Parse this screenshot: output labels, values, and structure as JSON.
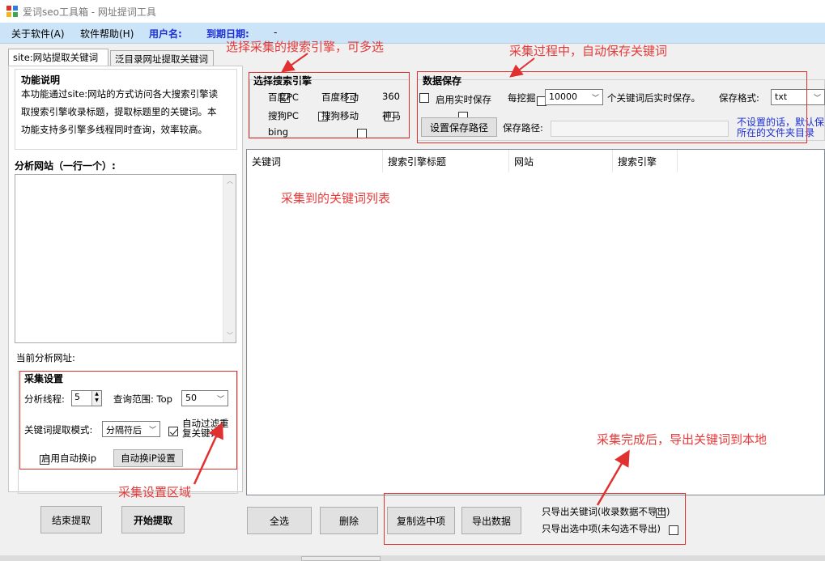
{
  "window": {
    "title": "爱词seo工具箱 - 网址提词工具"
  },
  "menu": {
    "about": "关于软件(A)",
    "help": "软件帮助(H)",
    "username_label": "用户名:",
    "expiry_label": "到期日期:",
    "expiry_value": "-"
  },
  "tabs": [
    "site:网站提取关键词",
    "泛目录网址提取关键词"
  ],
  "left": {
    "func_title": "功能说明",
    "func_lines": [
      "本功能通过site:网站的方式访问各大搜索引擎读",
      "取搜索引擎收录标题，提取标题里的关键词。本",
      "功能支持多引擎多线程同时查询，效率较高。"
    ],
    "analyze_label": "分析网站（一行一个）:",
    "current_label": "当前分析网址:",
    "settings": {
      "title": "采集设置",
      "threads_label": "分析线程:",
      "threads_value": "5",
      "range_label": "查询范围: Top",
      "range_value": "50",
      "mode_label": "关键词提取模式:",
      "mode_value": "分隔符后",
      "dedupe_label_1": "自动过滤重",
      "dedupe_label_2": "复关键词",
      "auto_ip_label": "启用自动换ip",
      "auto_ip_button": "自动换iP设置"
    },
    "stop_button": "结束提取",
    "start_button": "开始提取"
  },
  "engines": {
    "title": "选择搜索引擎",
    "items": [
      {
        "label": "百度PC",
        "checked": true
      },
      {
        "label": "百度移动",
        "checked": false
      },
      {
        "label": "360",
        "checked": false
      },
      {
        "label": "搜狗PC",
        "checked": false
      },
      {
        "label": "搜狗移动",
        "checked": false
      },
      {
        "label": "神马",
        "checked": false
      },
      {
        "label": "bing",
        "checked": false
      }
    ]
  },
  "save": {
    "title": "数据保存",
    "realtime_label": "启用实时保存",
    "per_label": "每挖掘",
    "per_value": "10000",
    "after_label": "个关键词后实时保存。",
    "format_label": "保存格式:",
    "format_value": "txt",
    "path_button": "设置保存路径",
    "path_label": "保存路径:",
    "path_value": "",
    "note_1": "不设置的话，默认保",
    "note_2": "所在的文件夹目录"
  },
  "table": {
    "columns": [
      "关键词",
      "搜索引擎标题",
      "网站",
      "搜索引擎"
    ]
  },
  "bottom": {
    "select_all": "全选",
    "delete": "删除",
    "copy_selected": "复制选中项",
    "export": "导出数据",
    "export_kw_only": "只导出关键词(收录数据不导出)",
    "export_checked_only": "只导出选中项(未勾选不导出)"
  },
  "annotations": {
    "engine": "选择采集的搜索引擎，可多选",
    "autosave": "采集过程中，自动保存关键词",
    "list": "采集到的关键词列表",
    "export": "采集完成后，导出关键词到本地",
    "settings": "采集设置区域"
  },
  "colors": {
    "annotation": "#e63a3a",
    "menu_blue": "#1d2fd6",
    "menubar": "#cce4f7"
  }
}
